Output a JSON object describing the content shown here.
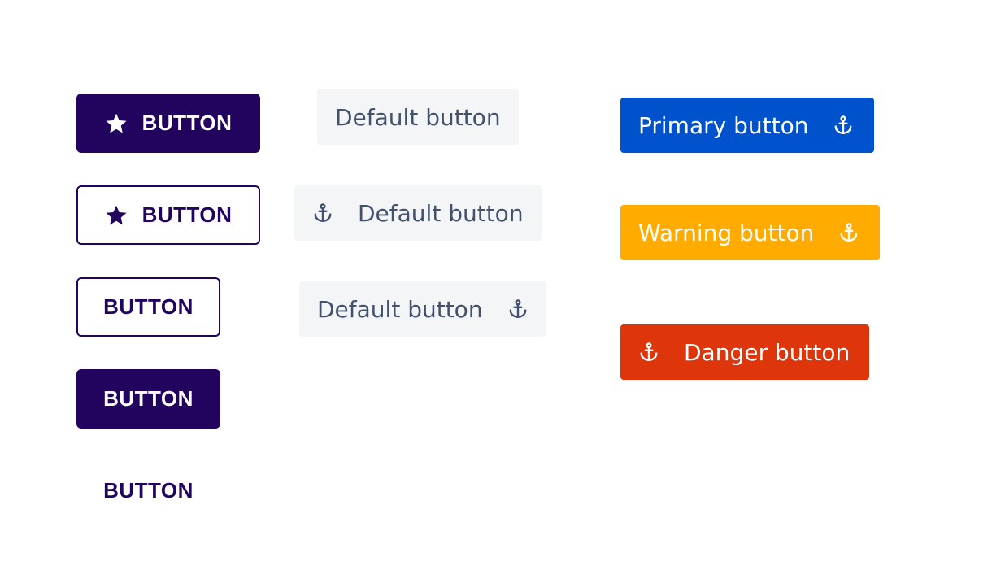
{
  "colors": {
    "purple": "#22045f",
    "default_bg": "#f4f5f7",
    "default_text": "#42526e",
    "primary": "#0052cc",
    "warning": "#ffab00",
    "danger": "#de350b"
  },
  "material_buttons": {
    "filled_icon_label": "BUTTON",
    "outline_icon_label": "BUTTON",
    "outline_label": "BUTTON",
    "filled_label": "BUTTON",
    "text_label": "BUTTON",
    "icon": "star-icon"
  },
  "default_buttons": {
    "plain_label": "Default button",
    "icon_before_label": "Default button",
    "icon_after_label": "Default button",
    "icon": "anchor-icon"
  },
  "appearance_buttons": {
    "primary_label": "Primary button",
    "warning_label": "Warning button",
    "danger_label": "Danger button",
    "icon": "anchor-icon"
  }
}
